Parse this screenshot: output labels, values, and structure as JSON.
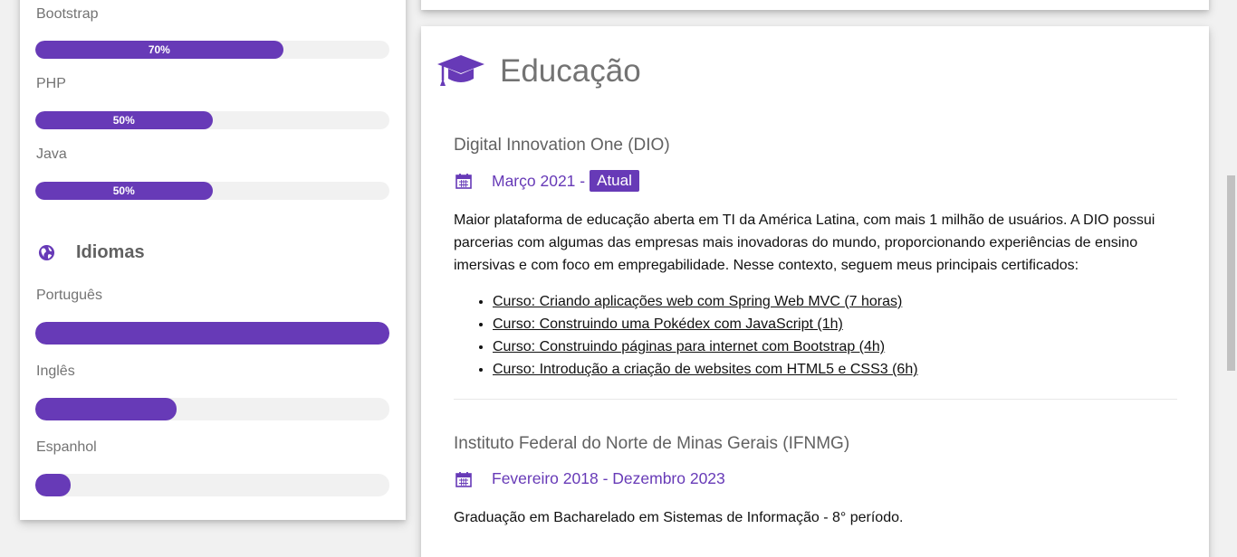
{
  "skills": {
    "items": [
      {
        "label": "Bootstrap",
        "percent_text": "70%",
        "fill": 0.7
      },
      {
        "label": "PHP",
        "percent_text": "50%",
        "fill": 0.5
      },
      {
        "label": "Java",
        "percent_text": "50%",
        "fill": 0.5
      }
    ]
  },
  "languages": {
    "title": "Idiomas",
    "icon": "globe-icon",
    "items": [
      {
        "label": "Português",
        "fill": 1.0
      },
      {
        "label": "Inglês",
        "fill": 0.4
      },
      {
        "label": "Espanhol",
        "fill": 0.1
      }
    ]
  },
  "education": {
    "title": "Educação",
    "icon": "graduation-cap-icon",
    "accent": "#673ab7",
    "entries": [
      {
        "institution": "Digital Innovation One (DIO)",
        "date": "Março 2021 - ",
        "badge": "Atual",
        "description": "Maior plataforma de educação aberta em TI da América Latina, com mais 1 milhão de usuários. A DIO possui parcerias com algumas das empresas mais inovadoras do mundo, proporcionando experiências de ensino imersivas e com foco em empregabilidade. Nesse contexto, seguem meus principais certificados:",
        "courses": [
          "Curso: Criando aplicações web com Spring Web MVC (7 horas)",
          "Curso: Construindo uma Pokédex com JavaScript (1h)",
          "Curso: Construindo páginas para internet com Bootstrap (4h)",
          "Curso: Introdução a criação de websites com HTML5 e CSS3 (6h)"
        ]
      },
      {
        "institution": "Instituto Federal do Norte de Minas Gerais (IFNMG)",
        "date": "Fevereiro 2018 - Dezembro 2023",
        "description": "Graduação em Bacharelado em Sistemas de Informação - 8° período."
      }
    ]
  }
}
